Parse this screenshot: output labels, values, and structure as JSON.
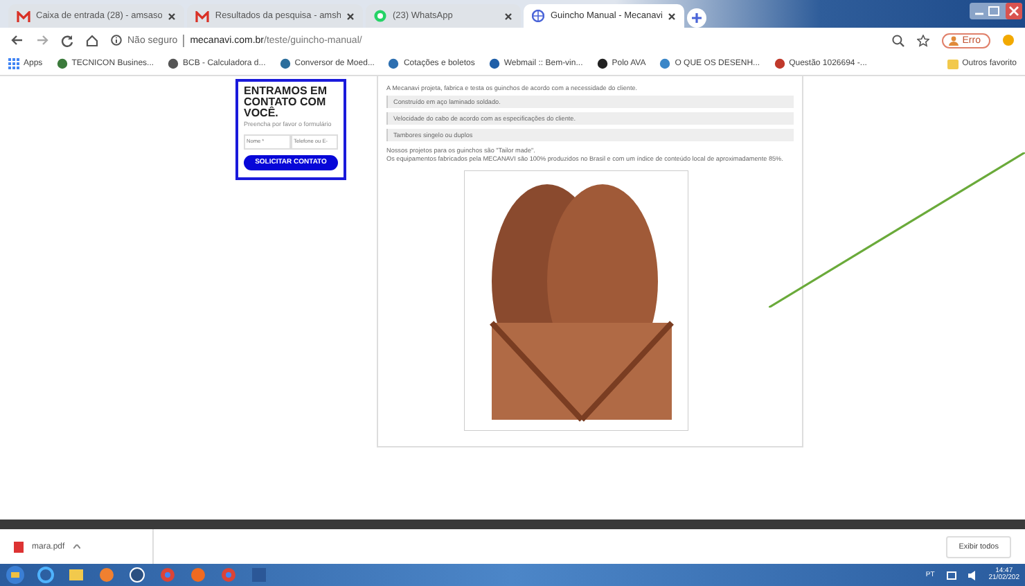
{
  "tabs": [
    {
      "kind": "mail",
      "label": "Caixa de entrada (28) - amsaso",
      "selected": false
    },
    {
      "kind": "mail",
      "label": "Resultados da pesquisa - amsh",
      "selected": false
    },
    {
      "kind": "chat",
      "label": "(23) WhatsApp",
      "selected": false
    },
    {
      "kind": "globe",
      "label": "Guincho Manual - Mecanavi",
      "selected": true
    }
  ],
  "address_bar": {
    "security": "Não seguro",
    "domain": "mecanavi.com.br",
    "path": "/teste/guincho-manual/",
    "profile": "Erro"
  },
  "bookmarks": [
    "Apps",
    "TECNICON Busines...",
    "BCB - Calculadora d...",
    "Conversor de Moed...",
    "Cotações e boletos",
    "Webmail :: Bem-vin...",
    "Polo AVA",
    "O QUE OS DESENH...",
    "Questão 1026694 -..."
  ],
  "other_bookmarks": "Outros favorito",
  "contact_form": {
    "title": "ENTRAMOS EM CONTATO COM VOCÊ.",
    "subtitle": "Preencha por favor o formulário",
    "fields": [
      {
        "placeholder": "Nome *"
      },
      {
        "placeholder": "Telefone ou E-"
      }
    ],
    "button": "SOLICITAR CONTATO"
  },
  "article": {
    "intro": "A Mecanavi projeta, fabrica e testa os guinchos de acordo com a necessidade do cliente.",
    "features": [
      "Construído em aço laminado soldado.",
      "Velocidade do cabo de acordo com as especificações do cliente.",
      "Tambores singelo ou duplos"
    ],
    "paragraphs": [
      "Nossos projetos para os guinchos são \"Tailor made\".",
      "Os equipamentos fabricados pela MECANAVI são 100% produzidos no Brasil e com um índice de conteúdo local de aproximadamente 85%."
    ]
  },
  "downloads": {
    "file": "mara.pdf",
    "show_all": "Exibir todos"
  },
  "taskbar": {
    "language": "PT",
    "time": "14:47",
    "date": "21/02/202"
  }
}
